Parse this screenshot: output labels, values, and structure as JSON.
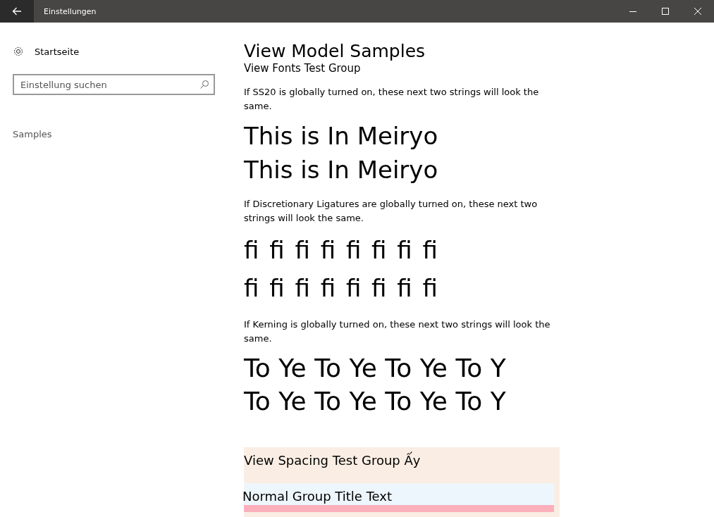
{
  "window": {
    "title": "Einstellungen"
  },
  "sidebar": {
    "home": "Startseite",
    "search": {
      "placeholder": "Einstellung suchen"
    },
    "section": "Samples"
  },
  "page": {
    "title": "View Model Samples",
    "group_title": "View Fonts Test Group",
    "samples": [
      {
        "kind": "meiryo",
        "note": "If SS20 is globally turned on, these next two strings will look the same.",
        "lines": [
          "This is In Meiryo",
          "This is In Meiryo"
        ]
      },
      {
        "kind": "ligature",
        "note": "If Discretionary Ligatures are globally turned on, these next two strings will look the same.",
        "lines": [
          "ﬁ ﬁ ﬁ ﬁ ﬁ ﬁ ﬁ ﬁ",
          "ﬁ ﬁ ﬁ ﬁ ﬁ ﬁ ﬁ ﬁ"
        ]
      },
      {
        "kind": "kerning",
        "note": "If Kerning is globally turned on, these next two strings will look the same.",
        "lines": [
          "To Ye To Ye To Ye To Y",
          "To Ye To Ye To Ye To Y"
        ]
      }
    ],
    "spacing_group": {
      "title": "View Spacing Test Group Ấy",
      "normal_title": "Normal Group Title Text"
    }
  }
}
